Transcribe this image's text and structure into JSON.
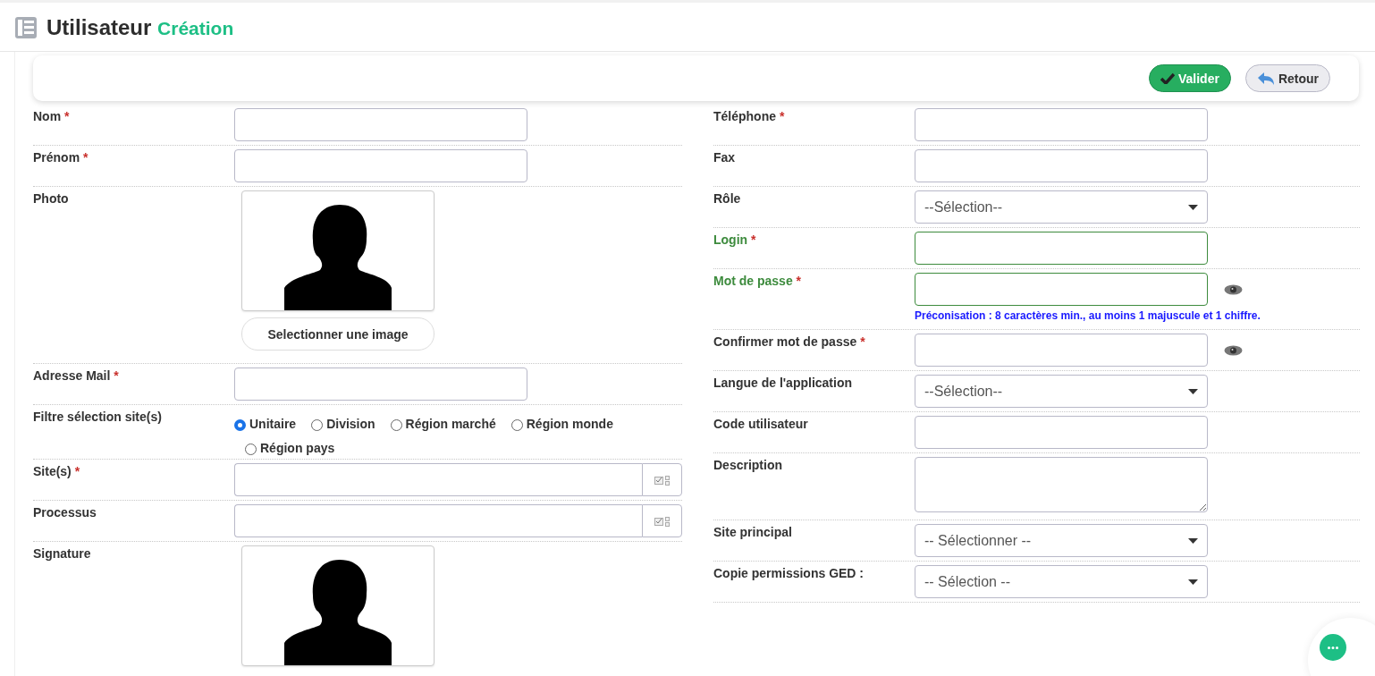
{
  "header": {
    "title": "Utilisateur",
    "subtitle": "Création"
  },
  "actions": [
    {
      "kind": "primary",
      "label": "Valider"
    },
    {
      "kind": "secondary",
      "label": "Retour"
    }
  ],
  "left_fields": [
    {
      "kind": "text",
      "label": "Nom",
      "required_mark": "*",
      "valid": false
    },
    {
      "kind": "text",
      "label": "Prénom",
      "required_mark": "*",
      "valid": false
    },
    {
      "kind": "image",
      "label": "Photo",
      "button": "Selectionner une image"
    },
    {
      "kind": "text",
      "label": "Adresse Mail",
      "required_mark": "*",
      "valid": false
    },
    {
      "kind": "radio",
      "label": "Filtre sélection site(s)",
      "options": [
        {
          "label": "Unitaire",
          "selected": true
        },
        {
          "label": "Division",
          "selected": false
        },
        {
          "label": "Région marché",
          "selected": false
        },
        {
          "label": "Région monde",
          "selected": false
        },
        {
          "label": "Région pays",
          "selected": false
        }
      ]
    },
    {
      "kind": "picker",
      "label": "Site(s)",
      "required_mark": "*"
    },
    {
      "kind": "picker",
      "label": "Processus"
    },
    {
      "kind": "image",
      "label": "Signature"
    }
  ],
  "right_fields": [
    {
      "kind": "text",
      "label": "Téléphone",
      "required_mark": "*",
      "valid": false
    },
    {
      "kind": "text",
      "label": "Fax",
      "valid": false
    },
    {
      "kind": "select",
      "label": "Rôle",
      "value": "--Sélection--"
    },
    {
      "kind": "text",
      "label": "Login",
      "required_mark": "*",
      "valid": true
    },
    {
      "kind": "password",
      "label": "Mot de passe",
      "required_mark": "*",
      "valid": true,
      "hint": "Préconisation : 8 caractères min., au moins 1 majuscule et 1 chiffre."
    },
    {
      "kind": "password",
      "label": "Confirmer mot de passe",
      "required_mark": "*",
      "valid": false
    },
    {
      "kind": "select",
      "label": "Langue de l'application",
      "value": "--Sélection--"
    },
    {
      "kind": "text",
      "label": "Code utilisateur",
      "valid": false
    },
    {
      "kind": "textarea",
      "label": "Description"
    },
    {
      "kind": "select",
      "label": "Site principal",
      "value": "-- Sélectionner --"
    },
    {
      "kind": "select",
      "label": "Copie permissions GED :",
      "value": "-- Sélection --"
    }
  ]
}
